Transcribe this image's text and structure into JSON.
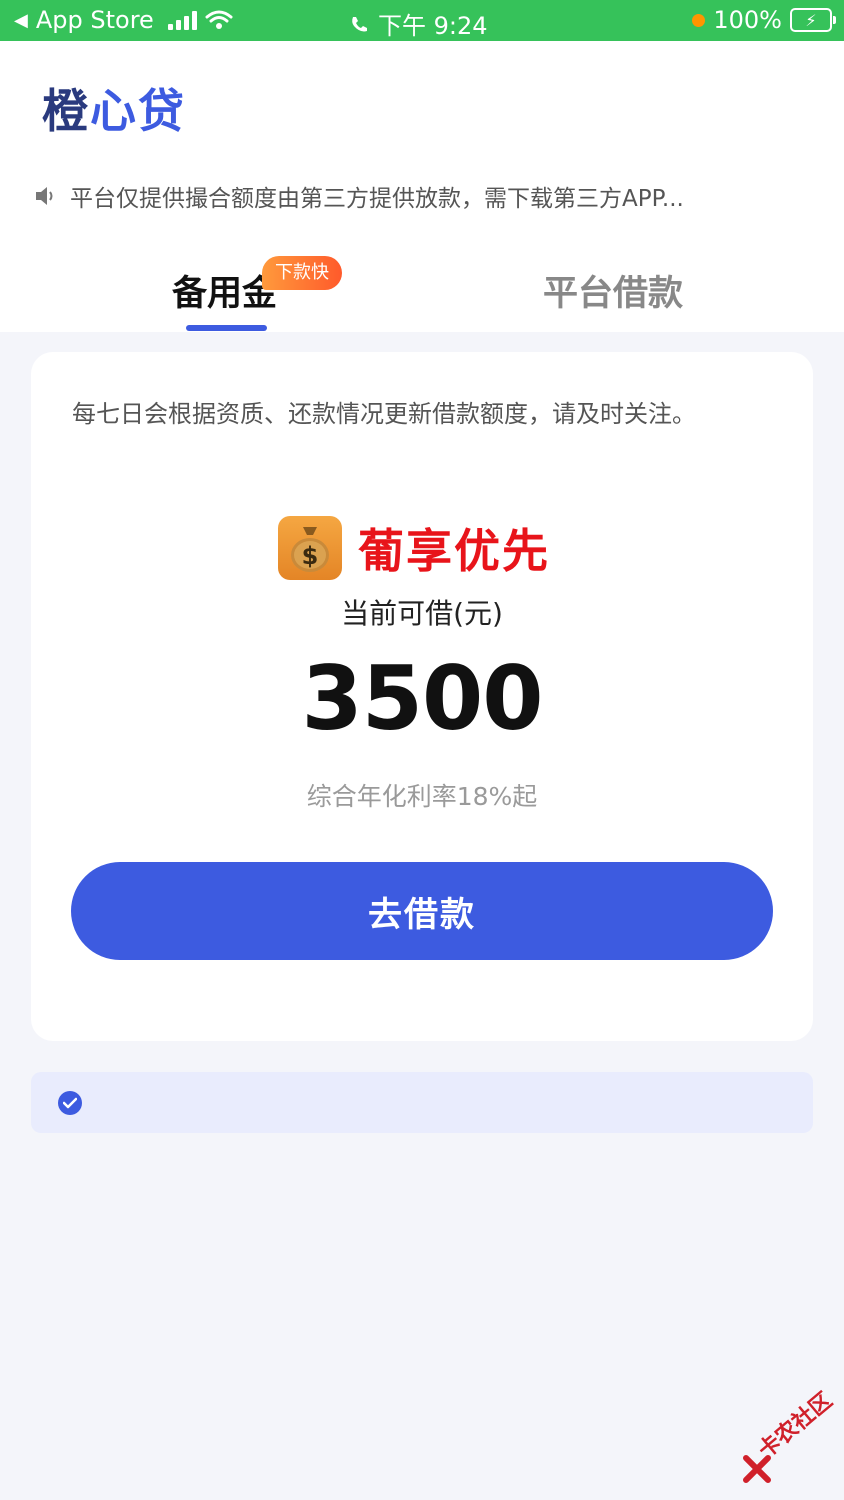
{
  "status_bar": {
    "back_app": "App Store",
    "time": "下午 9:24",
    "battery": "100%"
  },
  "header": {
    "logo_part1": "橙",
    "logo_part2": "心贷",
    "notice": "平台仅提供撮合额度由第三方提供放款，需下载第三方APP..."
  },
  "tabs": [
    {
      "label": "备用金",
      "badge": "下款快",
      "active": true
    },
    {
      "label": "平台借款",
      "active": false
    }
  ],
  "card": {
    "description": "每七日会根据资质、还款情况更新借款额度，请及时关注。",
    "promo": "葡享优先",
    "available_label": "当前可借(元)",
    "amount": "3500",
    "rate": "综合年化利率18%起",
    "button": "去借款"
  },
  "watermark": "卡农社区",
  "colors": {
    "status_green": "#36c25a",
    "brand_blue": "#3d5be0",
    "promo_red": "#e8141a",
    "badge_orange": "#ff6a2b"
  }
}
